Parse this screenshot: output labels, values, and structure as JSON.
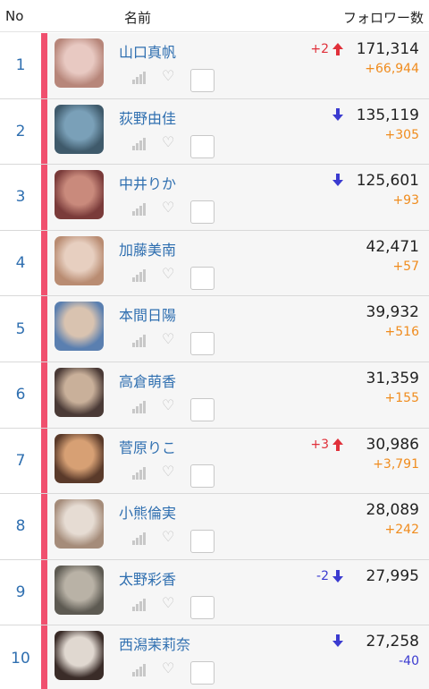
{
  "header": {
    "no": "No",
    "name": "名前",
    "followers": "フォロワー数"
  },
  "colors": {
    "accent_bar": "#f0506e",
    "link": "#2f6fb0",
    "up": "#e0303a",
    "down": "#3b3bd0",
    "gain": "#f08c1e"
  },
  "rows": [
    {
      "rank": "1",
      "name": "山口真帆",
      "rank_change": "+2",
      "direction": "up",
      "followers": "171,314",
      "gain": "+66,944",
      "gain_sign": "pos"
    },
    {
      "rank": "2",
      "name": "荻野由佳",
      "rank_change": "",
      "direction": "down",
      "followers": "135,119",
      "gain": "+305",
      "gain_sign": "pos"
    },
    {
      "rank": "3",
      "name": "中井りか",
      "rank_change": "",
      "direction": "down",
      "followers": "125,601",
      "gain": "+93",
      "gain_sign": "pos"
    },
    {
      "rank": "4",
      "name": "加藤美南",
      "rank_change": "",
      "direction": "none",
      "followers": "42,471",
      "gain": "+57",
      "gain_sign": "pos"
    },
    {
      "rank": "5",
      "name": "本間日陽",
      "rank_change": "",
      "direction": "none",
      "followers": "39,932",
      "gain": "+516",
      "gain_sign": "pos"
    },
    {
      "rank": "6",
      "name": "高倉萌香",
      "rank_change": "",
      "direction": "none",
      "followers": "31,359",
      "gain": "+155",
      "gain_sign": "pos"
    },
    {
      "rank": "7",
      "name": "菅原りこ",
      "rank_change": "+3",
      "direction": "up",
      "followers": "30,986",
      "gain": "+3,791",
      "gain_sign": "pos"
    },
    {
      "rank": "8",
      "name": "小熊倫実",
      "rank_change": "",
      "direction": "none",
      "followers": "28,089",
      "gain": "+242",
      "gain_sign": "pos"
    },
    {
      "rank": "9",
      "name": "太野彩香",
      "rank_change": "-2",
      "direction": "down",
      "followers": "27,995",
      "gain": "",
      "gain_sign": "pos"
    },
    {
      "rank": "10",
      "name": "西潟茉莉奈",
      "rank_change": "",
      "direction": "down",
      "followers": "27,258",
      "gain": "-40",
      "gain_sign": "neg"
    }
  ],
  "icons": {
    "signal": "signal-bars-icon",
    "favorite": "heart-icon",
    "select": "checkbox-icon"
  }
}
